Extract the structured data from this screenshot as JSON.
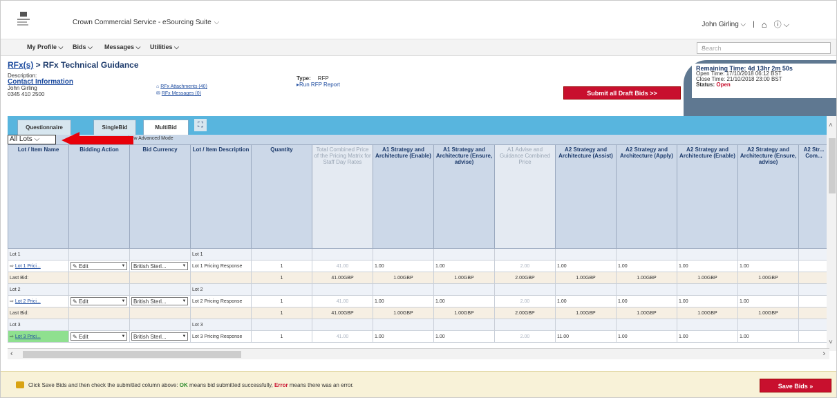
{
  "topbar": {
    "app_title": "Crown Commercial Service - eSourcing Suite",
    "user_name": "John Girling",
    "home_icon": "home-icon",
    "help_icon": "help-icon"
  },
  "nav": {
    "items": [
      "My Profile",
      "Bids",
      "Messages",
      "Utilities"
    ],
    "search_placeholder": "Search"
  },
  "breadcrumb": {
    "link": "RFx(s)",
    "separator": " > ",
    "current": "RFx Technical Guidance"
  },
  "description": {
    "label": "Description:",
    "contact_link": "Contact Information",
    "name": "John Girling",
    "phone": "0345 410 2500"
  },
  "attachments": {
    "attachments_link": "RFx Attachments (40)",
    "messages_link": "RFx Messages (0)"
  },
  "rfx_type": {
    "label": "Type:",
    "value": "RFP",
    "report_link": "Run RFP Report"
  },
  "submit_button": "Submit all Draft Bids >>",
  "timer": {
    "remaining_label": "Remaining Time:",
    "remaining_value": "4d 13hr 2m 50s",
    "open_label": "Open Time:",
    "open_value": "17/10/2018 06:12 BST",
    "close_label": "Close Time:",
    "close_value": "21/10/2018 23:00 BST",
    "status_label": "Status:",
    "status_value": "Open"
  },
  "tabs": [
    "Questionnaire",
    "SingleBid",
    "MultiBid"
  ],
  "lots_select": "All Lots",
  "advanced_text": "Show Advanced Mode",
  "table": {
    "headers": [
      "Lot / Item Name",
      "Bidding Action",
      "Bid Currency",
      "Lot / Item Description",
      "Quantity",
      "Total Combined Price of the Pricing Matrix for Staff Day Rates",
      "A1 Strategy and Architecture (Enable)",
      "A1 Strategy and Architecture (Ensure, advise)",
      "A1 Advise and Guidance Combined Price",
      "A2 Strategy and Architecture (Assist)",
      "A2 Strategy and Architecture (Apply)",
      "A2 Strategy and Architecture (Enable)",
      "A2 Strategy and Architecture (Ensure, advise)",
      "A2 Str... Com..."
    ],
    "dim_columns": [
      5,
      8
    ],
    "lots": [
      {
        "lot_label": "Lot 1",
        "lot_desc": "Lot 1",
        "item_name": "Lot 1 Prici...",
        "action": "Edit",
        "currency": "British Sterl...",
        "description": "Lot 1 Pricing Response",
        "quantity": "1",
        "values": [
          "41.00",
          "1.00",
          "1.00",
          "2.00",
          "1.00",
          "1.00",
          "1.00",
          "1.00"
        ],
        "last_bid_label": "Last Bid:",
        "last_bid": [
          "1",
          "41.00GBP",
          "1.00GBP",
          "1.00GBP",
          "2.00GBP",
          "1.00GBP",
          "1.00GBP",
          "1.00GBP",
          "1.00GBP"
        ],
        "highlight": false
      },
      {
        "lot_label": "Lot 2",
        "lot_desc": "Lot 2",
        "item_name": "Lot 2 Prici...",
        "action": "Edit",
        "currency": "British Sterl...",
        "description": "Lot 2 Pricing Response",
        "quantity": "1",
        "values": [
          "41.00",
          "1.00",
          "1.00",
          "2.00",
          "1.00",
          "1.00",
          "1.00",
          "1.00"
        ],
        "last_bid_label": "Last Bid:",
        "last_bid": [
          "1",
          "41.00GBP",
          "1.00GBP",
          "1.00GBP",
          "2.00GBP",
          "1.00GBP",
          "1.00GBP",
          "1.00GBP",
          "1.00GBP"
        ],
        "highlight": false
      },
      {
        "lot_label": "Lot 3",
        "lot_desc": "Lot 3",
        "item_name": "Lot 3 Prici...",
        "action": "Edit",
        "currency": "British Sterl...",
        "description": "Lot 3 Pricing Response",
        "quantity": "1",
        "values": [
          "41.00",
          "1.00",
          "1.00",
          "2.00",
          "11.00",
          "1.00",
          "1.00",
          "1.00"
        ],
        "highlight": true
      }
    ]
  },
  "footer": {
    "msg_before": "Click Save Bids and then check the submitted column above: ",
    "ok": "OK",
    "msg_mid": " means bid submitted successfully, ",
    "error": "Error",
    "msg_after": " means there was an error.",
    "save_button": "Save Bids"
  },
  "colors": {
    "accent_blue": "#58b5de",
    "button_red": "#c8102e",
    "footer_bg": "#f8f2d8",
    "annotation_arrow": "#e8000a"
  }
}
